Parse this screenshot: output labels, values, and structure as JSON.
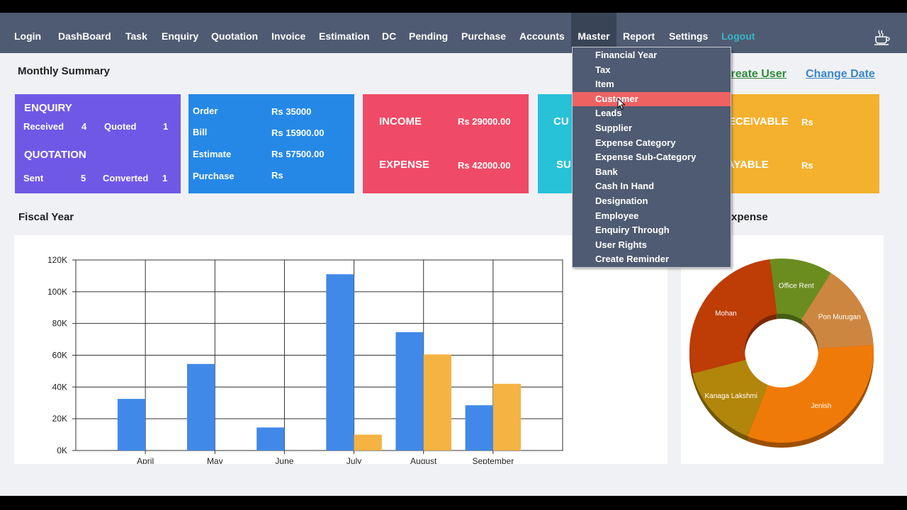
{
  "nav": {
    "items": [
      "Login",
      "DashBoard",
      "Task",
      "Enquiry",
      "Quotation",
      "Invoice",
      "Estimation",
      "DC",
      "Pending",
      "Purchase",
      "Accounts",
      "Master",
      "Report",
      "Settings",
      "Logout"
    ],
    "active": "Master",
    "icon": "coffee-cup-icon"
  },
  "header": {
    "monthly_summary": "Monthly Summary",
    "create_user": "Create User",
    "change_date": "Change Date"
  },
  "cards": {
    "enquiry": {
      "title": "ENQUIRY",
      "received_label": "Received",
      "received_value": "4",
      "quoted_label": "Quoted",
      "quoted_value": "1",
      "quotation_title": "QUOTATION",
      "sent_label": "Sent",
      "sent_value": "5",
      "converted_label": "Converted",
      "converted_value": "1",
      "color": "#7058e6"
    },
    "order": {
      "rows": [
        {
          "label": "Order",
          "value": "Rs 35000"
        },
        {
          "label": "Bill",
          "value": "Rs 15900.00"
        },
        {
          "label": "Estimate",
          "value": "Rs 57500.00"
        },
        {
          "label": "Purchase",
          "value": "Rs"
        }
      ],
      "color": "#2688e6"
    },
    "income": {
      "income_label": "INCOME",
      "income_value": "Rs 29000.00",
      "expense_label": "EXPENSE",
      "expense_value": "Rs 42000.00",
      "color": "#ef4b66"
    },
    "customer": {
      "line1": "CU",
      "line2": "SU",
      "color": "#27c2d8"
    },
    "receivable": {
      "receivable_label": "RECEIVABLE",
      "receivable_value": "Rs",
      "payable_label": "PAYABLE",
      "payable_value": "Rs",
      "color": "#f3b12e"
    }
  },
  "sections": {
    "fiscal_year": "Fiscal Year",
    "expense": "Expense"
  },
  "chart_data": [
    {
      "type": "bar",
      "categories": [
        "April",
        "May",
        "June",
        "July",
        "August",
        "September"
      ],
      "series": [
        {
          "values": [
            32500,
            54500,
            14500,
            111000,
            74500,
            28500
          ],
          "color": "#4189e8"
        },
        {
          "values": [
            0,
            0,
            0,
            10000,
            60500,
            42000
          ],
          "color": "#f4b342"
        }
      ],
      "yticks": [
        "0K",
        "20K",
        "40K",
        "60K",
        "80K",
        "100K",
        "120K"
      ],
      "ylim": [
        0,
        120000
      ],
      "grid": true
    },
    {
      "type": "pie",
      "donut": true,
      "slices": [
        {
          "label": "Mohan",
          "value": 27,
          "color": "#be3c05"
        },
        {
          "label": "Office Rent",
          "value": 11,
          "color": "#6b8c1f"
        },
        {
          "label": "Pon Murugan",
          "value": 15,
          "color": "#cd8640"
        },
        {
          "label": "Jenish",
          "value": 32,
          "color": "#f07a07"
        },
        {
          "label": "Kanaga Lakshmi",
          "value": 15,
          "color": "#b2850b"
        }
      ]
    }
  ],
  "dropdown": {
    "items": [
      "Financial Year",
      "Tax",
      "Item",
      "Customer",
      "Leads",
      "Supplier",
      "Expense Category",
      "Expense Sub-Category",
      "Bank",
      "Cash In Hand",
      "Designation",
      "Employee",
      "Enquiry Through",
      "User Rights",
      "Create Reminder"
    ],
    "highlighted": "Customer"
  }
}
